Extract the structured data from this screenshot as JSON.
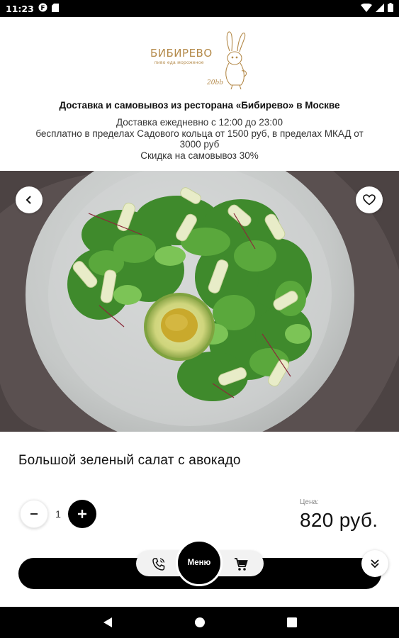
{
  "status_bar": {
    "time": "11:23",
    "icons": [
      "notification-f-icon",
      "sd-card-icon",
      "wifi-icon",
      "cellular-icon",
      "battery-icon"
    ]
  },
  "header": {
    "logo": {
      "name": "БИБИРЕВО",
      "tagline": "пиво еда мороженое",
      "year": "20bb"
    },
    "title": "Доставка и самовывоз из ресторана «Бибирево» в Москве",
    "info_lines": [
      "Доставка ежедневно с 12:00 до 23:00",
      "бесплатно в пределах Садового кольца от 1500 руб, в пределах МКАД от",
      "3000 руб",
      "Скидка на самовывоз 30%"
    ]
  },
  "hero": {
    "back_icon": "chevron-left-icon",
    "favorite_icon": "heart-outline-icon"
  },
  "product": {
    "title": "Большой зеленый салат с авокадо",
    "quantity": "1",
    "price_label": "Цена:",
    "price": "820 руб."
  },
  "bottom": {
    "menu_label": "Меню",
    "phone_icon": "phone-icon",
    "cart_icon": "cart-icon",
    "scroll_icon": "double-chevron-down-icon"
  },
  "colors": {
    "accent": "#000000",
    "logo_gold": "#b48a4a",
    "hero_background": "#5c5252"
  }
}
